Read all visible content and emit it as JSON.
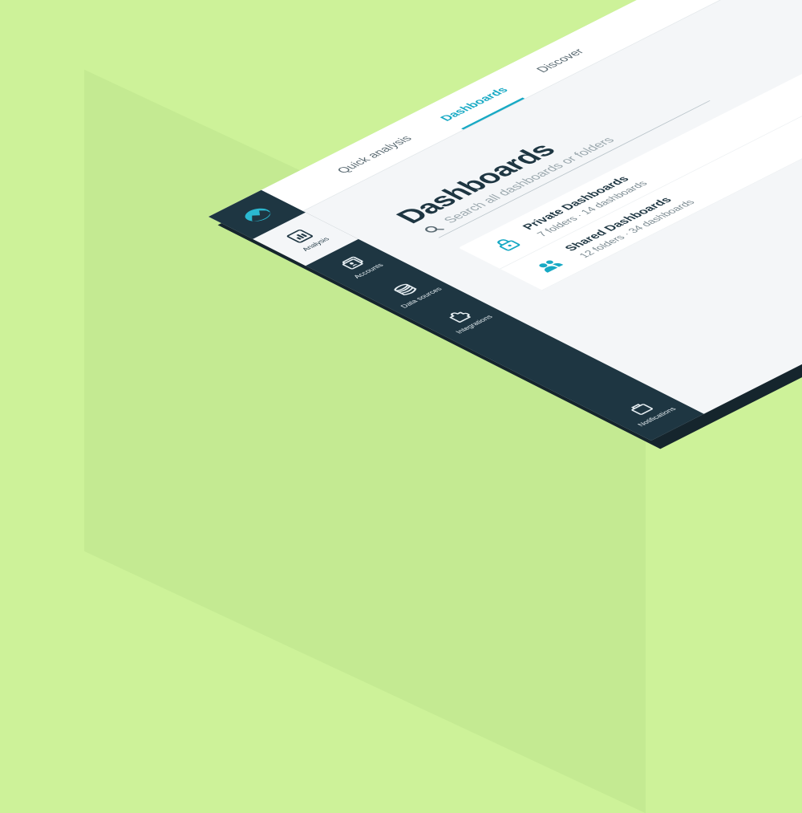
{
  "tabs": [
    {
      "label": "Quick analysis",
      "active": false
    },
    {
      "label": "Dashboards",
      "active": true
    },
    {
      "label": "Discover",
      "active": false
    }
  ],
  "sidebar": {
    "items": [
      {
        "label": "Analysis",
        "icon": "bar-chart-icon",
        "active": true
      },
      {
        "label": "Accounts",
        "icon": "accounts-icon",
        "active": false
      },
      {
        "label": "Data sources",
        "icon": "database-icon",
        "active": false
      },
      {
        "label": "Integrations",
        "icon": "puzzle-icon",
        "active": false
      }
    ],
    "bottom_item": {
      "label": "Notifications",
      "icon": "notifications-icon"
    }
  },
  "main": {
    "title": "Dashboards",
    "search_placeholder": "Search all dashboards or folders",
    "items": [
      {
        "title": "Private Dashboards",
        "subtitle": "7 folders · 14 dashboards",
        "icon": "lock-icon"
      },
      {
        "title": "Shared Dashboards",
        "subtitle": "12 folders · 34 dashboards",
        "icon": "users-icon"
      }
    ]
  },
  "colors": {
    "accent": "#17a9c4",
    "sidebar": "#1e3642",
    "background": "#cdf299"
  }
}
